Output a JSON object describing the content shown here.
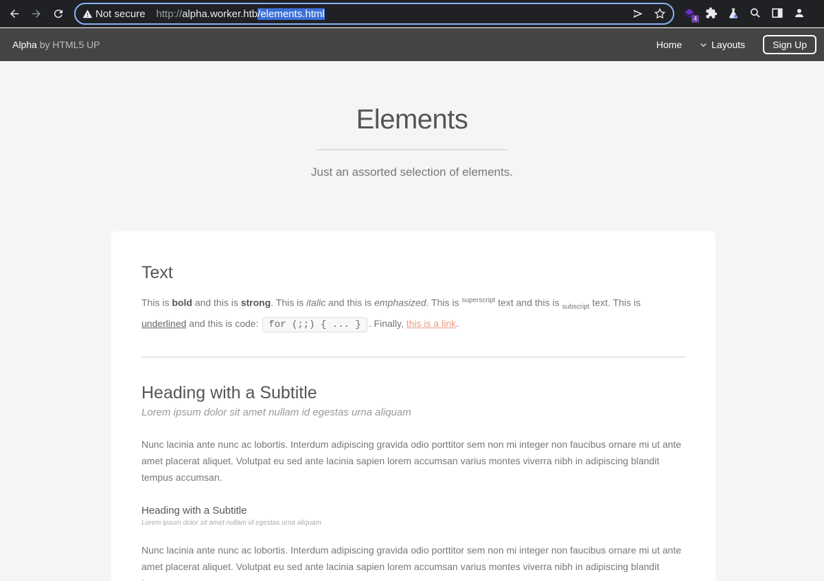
{
  "browser": {
    "security_label": "Not secure",
    "url_scheme": "http://",
    "url_host": "alpha.worker.htb",
    "url_path": "/elements.html",
    "extension_badge": "4"
  },
  "site": {
    "brand_name": "Alpha",
    "brand_by": "by HTML5 UP",
    "nav": {
      "home": "Home",
      "layouts": "Layouts",
      "signup": "Sign Up"
    }
  },
  "banner": {
    "title": "Elements",
    "tagline": "Just an assorted selection of elements."
  },
  "content": {
    "text_heading": "Text",
    "t1": "This is ",
    "bold": "bold",
    "t2": " and this is ",
    "strong": "strong",
    "t3": ". This is ",
    "italic": "italic",
    "t4": " and this is ",
    "emphasized": "emphasized",
    "t5": ". This is ",
    "superscript": "superscript",
    "t6": " text and this is ",
    "subscript": "subscript",
    "t7": " text. This is ",
    "underlined": "underlined",
    "t8": " and this is code: ",
    "code": "for (;;) { ... }",
    "t9": ". Finally, ",
    "link": "this is a link",
    "t10": ".",
    "heading2": "Heading with a Subtitle",
    "subtitle2": "Lorem ipsum dolor sit amet nullam id egestas urna aliquam",
    "para1": "Nunc lacinia ante nunc ac lobortis. Interdum adipiscing gravida odio porttitor sem non mi integer non faucibus ornare mi ut ante amet placerat aliquet. Volutpat eu sed ante lacinia sapien lorem accumsan varius montes viverra nibh in adipiscing blandit tempus accumsan.",
    "heading3": "Heading with a Subtitle",
    "subtitle3": "Lorem ipsum dolor sit amet nullam id egestas urna aliquam",
    "para2": "Nunc lacinia ante nunc ac lobortis. Interdum adipiscing gravida odio porttitor sem non mi integer non faucibus ornare mi ut ante amet placerat aliquet. Volutpat eu sed ante lacinia sapien lorem accumsan varius montes viverra nibh in adipiscing blandit tempus accumsan."
  },
  "colors": {
    "header_bg": "#444444",
    "page_bg": "#f5f5f5",
    "link": "#e89980",
    "omnibox_border": "#8ab4f8"
  }
}
